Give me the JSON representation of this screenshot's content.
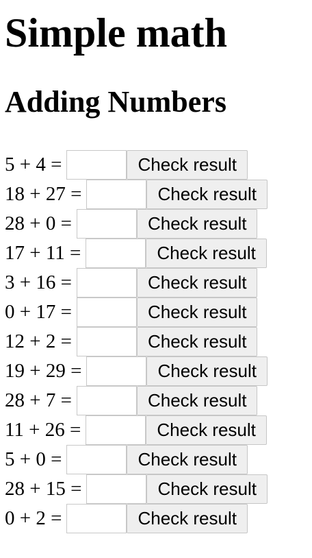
{
  "page": {
    "title": "Simple math",
    "subtitle": "Adding Numbers"
  },
  "problems": [
    {
      "expression": "5 + 4 =",
      "answer": "",
      "button_label": "Check result"
    },
    {
      "expression": "18 + 27 =",
      "answer": "",
      "button_label": "Check result"
    },
    {
      "expression": "28 + 0 =",
      "answer": "",
      "button_label": "Check result"
    },
    {
      "expression": "17 + 11 =",
      "answer": "",
      "button_label": "Check result"
    },
    {
      "expression": "3 + 16 =",
      "answer": "",
      "button_label": "Check result"
    },
    {
      "expression": "0 + 17 =",
      "answer": "",
      "button_label": "Check result"
    },
    {
      "expression": "12 + 2 =",
      "answer": "",
      "button_label": "Check result"
    },
    {
      "expression": "19 + 29 =",
      "answer": "",
      "button_label": "Check result"
    },
    {
      "expression": "28 + 7 =",
      "answer": "",
      "button_label": "Check result"
    },
    {
      "expression": "11 + 26 =",
      "answer": "",
      "button_label": "Check result"
    },
    {
      "expression": "5 + 0 =",
      "answer": "",
      "button_label": "Check result"
    },
    {
      "expression": "28 + 15 =",
      "answer": "",
      "button_label": "Check result"
    },
    {
      "expression": "0 + 2 =",
      "answer": "",
      "button_label": "Check result"
    }
  ]
}
